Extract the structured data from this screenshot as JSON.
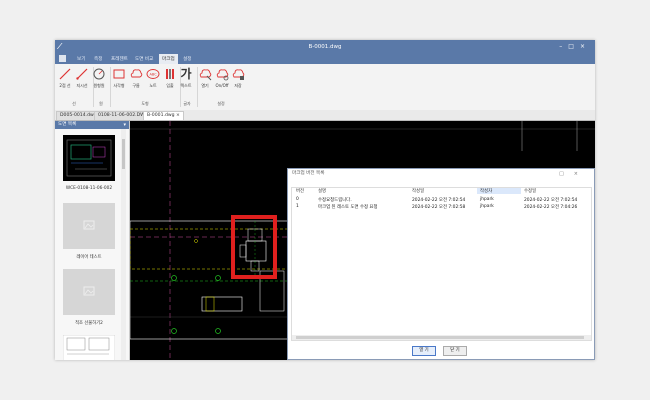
{
  "window": {
    "title": "B-0001.dwg"
  },
  "menu": {
    "items": [
      "보기",
      "측정",
      "프레젠트",
      "도면 비교",
      "마크업",
      "설정"
    ],
    "active_index": 4
  },
  "ribbon": {
    "buttons": [
      {
        "label": "2점 선",
        "icon": "line-icon"
      },
      {
        "label": "지시선",
        "icon": "leader-icon"
      },
      {
        "label": "원형원",
        "icon": "circle-icon"
      },
      {
        "label": "사각형",
        "icon": "rectangle-icon"
      },
      {
        "label": "구름",
        "icon": "cloud-icon"
      },
      {
        "label": "노트",
        "icon": "note-icon"
      },
      {
        "label": "입출",
        "icon": "stamp-icon"
      },
      {
        "label": "텍스트",
        "icon": "text-icon",
        "glyph": "가"
      },
      {
        "label": "열기",
        "icon": "open-markup-icon"
      },
      {
        "label": "On/Off",
        "icon": "toggle-markup-icon"
      },
      {
        "label": "저장",
        "icon": "save-markup-icon"
      }
    ],
    "groups": [
      "선",
      "원",
      "도형",
      "글자",
      "설정"
    ]
  },
  "tabs": [
    {
      "label": "D005-0014.dwg"
    },
    {
      "label": "0108-11-06-002.DWG"
    },
    {
      "label": "B-0001.dwg",
      "active": true,
      "close": "×"
    }
  ],
  "sidebar": {
    "title": "도면 목록",
    "pin": "▾",
    "items": [
      {
        "caption": "WCE-0108-11-06-002"
      },
      {
        "caption": "레이어 테스트"
      },
      {
        "caption": "적조 선물하기2"
      }
    ]
  },
  "dialog": {
    "title": "마크업 버전 목록",
    "controls": [
      "□",
      "×"
    ],
    "columns": [
      "버전",
      "설명",
      "작성일",
      "작성자",
      "수정일"
    ],
    "rows": [
      {
        "version": "0",
        "description": "수정요청드립니다.",
        "created": "2024-02-22 오전 7:02:54",
        "author": "jhpark",
        "modified": "2024-02-22 오전 7:02:54"
      },
      {
        "version": "1",
        "description": "마크업 된 레스토 도면 수정 요청",
        "created": "2024-02-22 오전 7:02:58",
        "author": "jhpark",
        "modified": "2024-02-22 오전 7:04:26"
      }
    ],
    "buttons": {
      "open": "열 기",
      "close": "닫 기"
    }
  },
  "colors": {
    "titlebar": "#5a79a8",
    "canvas": "#000000",
    "highlight_box": "#e0201e",
    "cad_line": "#ffffff",
    "cad_green": "#22c222",
    "cad_yellow": "#e6e600",
    "cad_pink": "#d050a0",
    "selected_column": "#dbe8fb"
  }
}
